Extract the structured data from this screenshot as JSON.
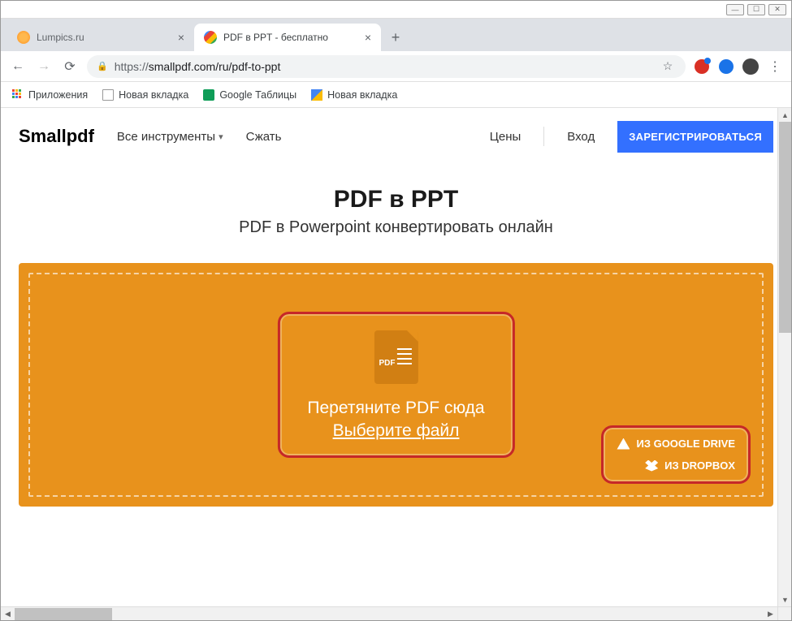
{
  "window": {
    "tabs": [
      {
        "title": "Lumpics.ru",
        "active": false
      },
      {
        "title": "PDF в PPT - бесплатно",
        "active": true
      }
    ]
  },
  "addressbar": {
    "scheme": "https://",
    "url": "smallpdf.com/ru/pdf-to-ppt"
  },
  "bookmarks": {
    "apps": "Приложения",
    "items": [
      "Новая вкладка",
      "Google Таблицы",
      "Новая вкладка"
    ]
  },
  "site": {
    "logo": "Smallpdf",
    "nav": {
      "all_tools": "Все инструменты",
      "compress": "Сжать",
      "pricing": "Цены",
      "login": "Вход",
      "signup": "ЗАРЕГИСТРИРОВАТЬСЯ"
    },
    "hero": {
      "title": "PDF в PPT",
      "subtitle": "PDF в Powerpoint конвертировать онлайн"
    },
    "dropzone": {
      "pdf_badge": "PDF",
      "drag_text": "Перетяните PDF сюда",
      "choose_file": "Выберите файл",
      "from_gdrive": "ИЗ GOOGLE DRIVE",
      "from_dropbox": "ИЗ DROPBOX"
    }
  }
}
